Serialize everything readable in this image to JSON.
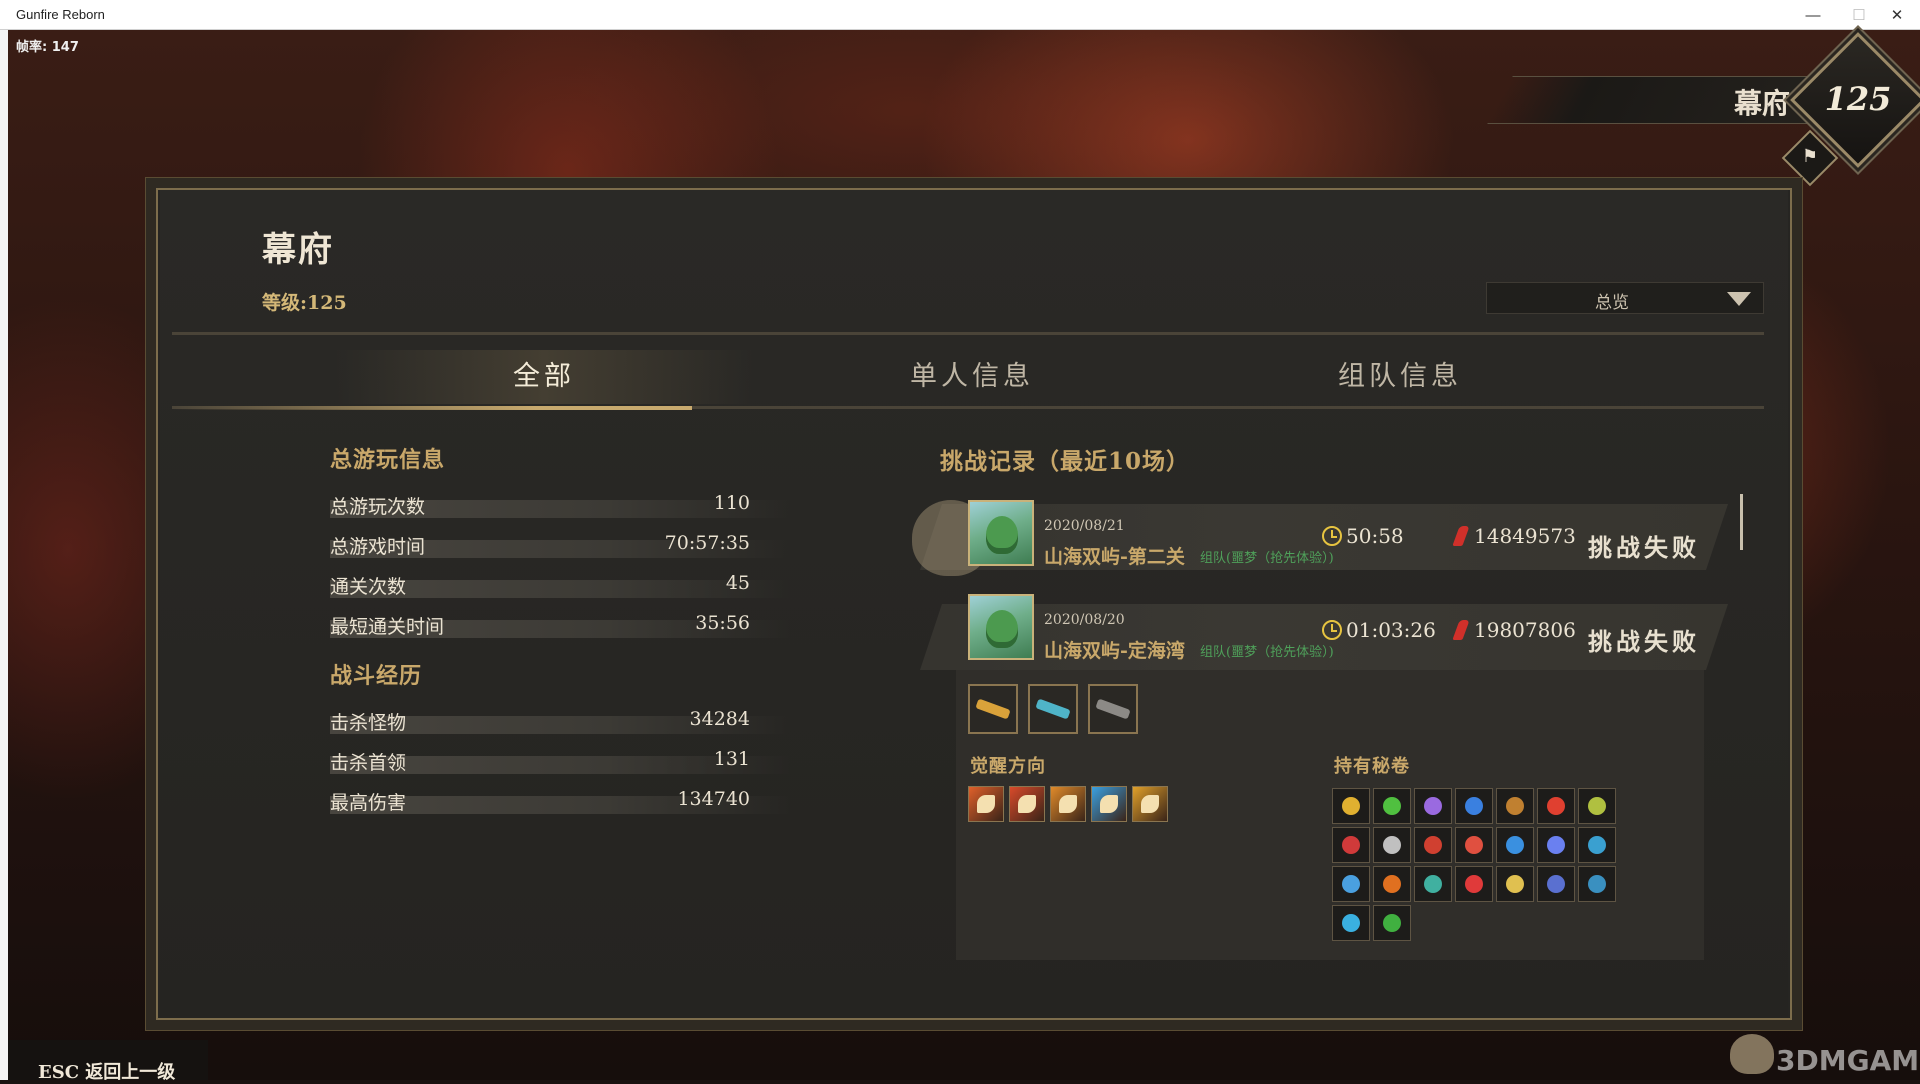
{
  "window": {
    "title": "Gunfire Reborn",
    "min": "—",
    "max": "☐",
    "close": "✕"
  },
  "fps": "帧率: 147",
  "rank": {
    "name": "幕府",
    "level": "125"
  },
  "panel": {
    "title": "幕府",
    "level": "等级:125",
    "dropdown": "总览"
  },
  "tabs": [
    "全部",
    "单人信息",
    "组队信息"
  ],
  "play_info": {
    "heading": "总游玩信息",
    "rows": [
      {
        "label": "总游玩次数",
        "value": "110"
      },
      {
        "label": "总游戏时间",
        "value": "70:57:35"
      },
      {
        "label": "通关次数",
        "value": "45"
      },
      {
        "label": "最短通关时间",
        "value": "35:56"
      }
    ]
  },
  "combat": {
    "heading": "战斗经历",
    "rows": [
      {
        "label": "击杀怪物",
        "value": "34284"
      },
      {
        "label": "击杀首领",
        "value": "131"
      },
      {
        "label": "最高伤害",
        "value": "134740"
      }
    ]
  },
  "records": {
    "heading": "挑战记录（最近10场）",
    "items": [
      {
        "date": "2020/08/21",
        "map": "山海双屿-第二关",
        "team": "组队(噩梦（抢先体验）)",
        "time": "50:58",
        "damage": "14849573",
        "result": "挑战失败"
      },
      {
        "date": "2020/08/20",
        "map": "山海双屿-定海湾",
        "team": "组队(噩梦（抢先体验）)",
        "time": "01:03:26",
        "damage": "19807806",
        "result": "挑战失败"
      }
    ]
  },
  "detail": {
    "awaken_heading": "觉醒方向",
    "scrolls_heading": "持有秘卷",
    "weapons": [
      "weapon-1",
      "weapon-2",
      "weapon-3"
    ],
    "weapon_colors": [
      "#d9a23a",
      "#4fb4c8",
      "#8c8a86"
    ],
    "awaken_colors": [
      "#e0602a",
      "#d84a2a",
      "#e08a2a",
      "#3aa0e0",
      "#e0a02a"
    ],
    "scroll_colors": [
      "#e0b030",
      "#50c040",
      "#9a6ae0",
      "#3a80e0",
      "#c08030",
      "#e04030",
      "#b0c040",
      "#d03a3a",
      "#c0c0c0",
      "#d04030",
      "#e05040",
      "#3a90e0",
      "#6a80f0",
      "#3aa0d0",
      "#4aa0e0",
      "#e07020",
      "#40b0a0",
      "#e03a3a",
      "#e0c050",
      "#5a70d0",
      "#3a90c0",
      "#3ab0e0",
      "#40b040"
    ]
  },
  "footer": {
    "esc": "ESC 返回上一级",
    "watermark": "3DMGAME"
  }
}
